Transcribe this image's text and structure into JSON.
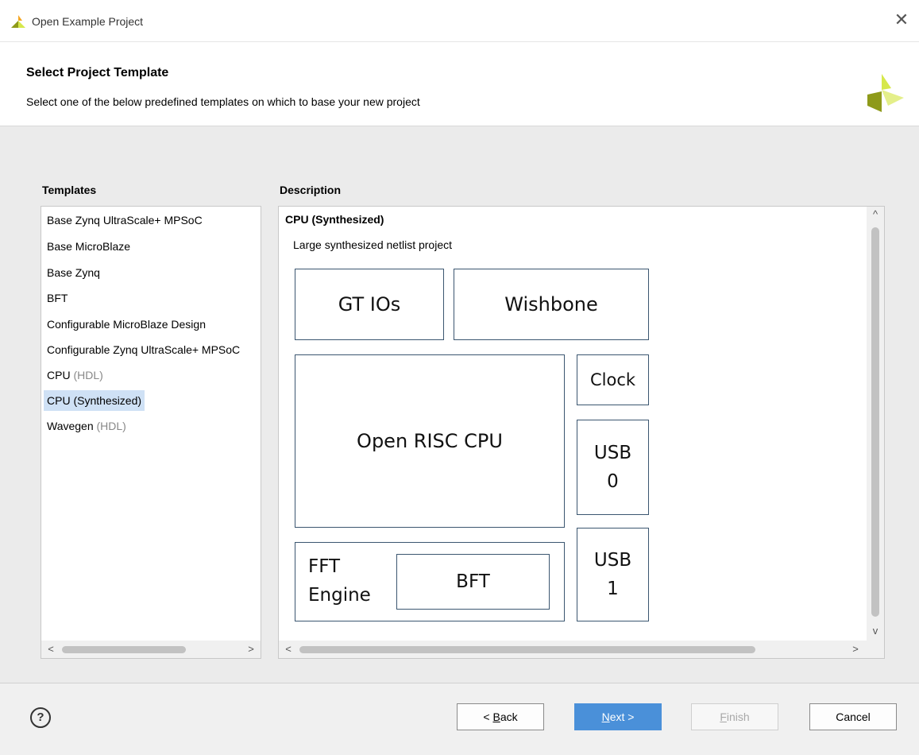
{
  "window": {
    "title": "Open Example Project"
  },
  "header": {
    "title": "Select Project Template",
    "subtitle": "Select one of the below predefined templates on which to base your new project"
  },
  "templates": {
    "label": "Templates",
    "items": [
      {
        "label": "Base Zynq UltraScale+ MPSoC",
        "suffix": ""
      },
      {
        "label": "Base MicroBlaze",
        "suffix": ""
      },
      {
        "label": "Base Zynq",
        "suffix": ""
      },
      {
        "label": "BFT",
        "suffix": ""
      },
      {
        "label": "Configurable MicroBlaze Design",
        "suffix": ""
      },
      {
        "label": "Configurable Zynq UltraScale+ MPSoC",
        "suffix": ""
      },
      {
        "label": "CPU",
        "suffix": "(HDL)"
      },
      {
        "label": "CPU (Synthesized)",
        "suffix": ""
      },
      {
        "label": "Wavegen",
        "suffix": "(HDL)"
      }
    ],
    "selected": "CPU (Synthesized)"
  },
  "description": {
    "label": "Description",
    "title": "CPU (Synthesized)",
    "subtitle": "Large synthesized netlist project",
    "blocks": {
      "gt_ios": "GT IOs",
      "wishbone": "Wishbone",
      "cpu": "Open RISC CPU",
      "clock": "Clock",
      "usb0_line1": "USB",
      "usb0_line2": "0",
      "usb1_line1": "USB",
      "usb1_line2": "1",
      "fft_line1": "FFT",
      "fft_line2": "Engine",
      "bft": "BFT"
    }
  },
  "footer": {
    "help": "?",
    "back_prefix": "< ",
    "back_mnemonic": "B",
    "back_rest": "ack",
    "next_mnemonic": "N",
    "next_rest": "ext >",
    "finish_mnemonic": "F",
    "finish_rest": "inish",
    "cancel": "Cancel"
  },
  "colors": {
    "accent": "#4a90d9",
    "selection": "#cfe1f5",
    "logo_light": "#d6e84b",
    "logo_dark": "#8e9a1a",
    "logo_orange": "#f5a623"
  }
}
